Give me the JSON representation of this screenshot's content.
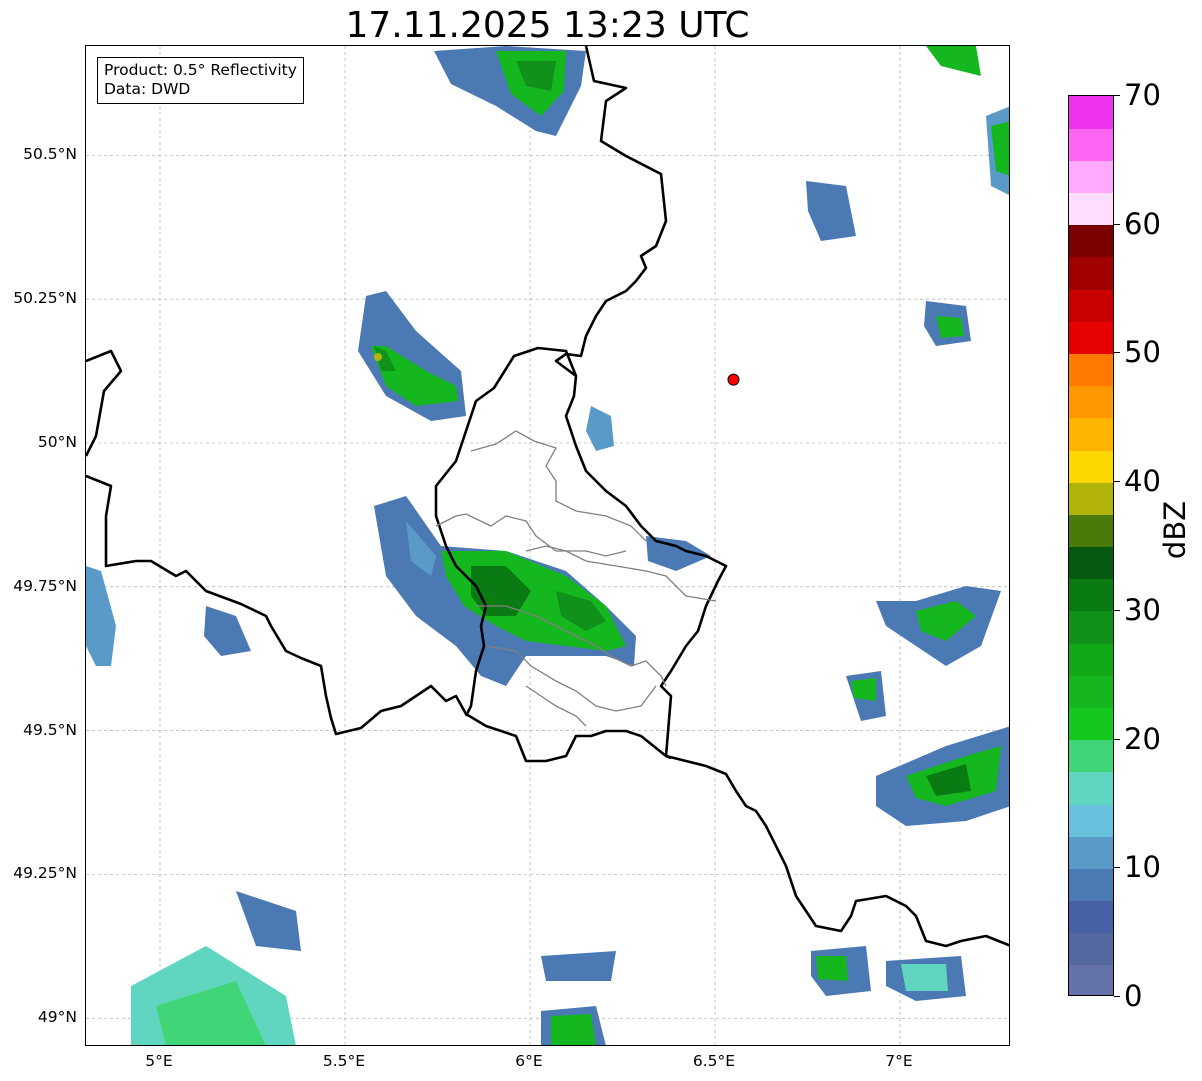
{
  "title": "17.11.2025 13:23 UTC",
  "info": {
    "product": "Product: 0.5° Reflectivity",
    "data": "Data: DWD"
  },
  "map": {
    "lon_range": [
      4.8,
      7.3
    ],
    "lat_range": [
      48.95,
      50.69
    ],
    "lon_ticks": [
      {
        "value": 5.0,
        "label": "5°E"
      },
      {
        "value": 5.5,
        "label": "5.5°E"
      },
      {
        "value": 6.0,
        "label": "6°E"
      },
      {
        "value": 6.5,
        "label": "6.5°E"
      },
      {
        "value": 7.0,
        "label": "7°E"
      }
    ],
    "lat_ticks": [
      {
        "value": 50.5,
        "label": "50.5°N"
      },
      {
        "value": 50.25,
        "label": "50.25°N"
      },
      {
        "value": 50.0,
        "label": "50°N"
      },
      {
        "value": 49.75,
        "label": "49.75°N"
      },
      {
        "value": 49.5,
        "label": "49.5°N"
      },
      {
        "value": 49.25,
        "label": "49.25°N"
      },
      {
        "value": 49.0,
        "label": "49°N"
      }
    ],
    "gridlines": true,
    "radar_site": {
      "lon": 6.55,
      "lat": 50.11,
      "color": "#ff0000"
    },
    "colors": {
      "border": "#000000",
      "admin_border": "#808080",
      "grid": "#b0b0b0"
    }
  },
  "colorbar": {
    "unit": "dBZ",
    "min": 0,
    "max": 70,
    "ticks": [
      {
        "value": 0,
        "label": "0"
      },
      {
        "value": 10,
        "label": "10"
      },
      {
        "value": 20,
        "label": "20"
      },
      {
        "value": 30,
        "label": "30"
      },
      {
        "value": 40,
        "label": "40"
      },
      {
        "value": 50,
        "label": "50"
      },
      {
        "value": 60,
        "label": "60"
      },
      {
        "value": 70,
        "label": "70"
      }
    ],
    "colors": [
      "#6373a8",
      "#5468a0",
      "#4560a4",
      "#4a79b4",
      "#5a9ac8",
      "#68c0dc",
      "#60d6c0",
      "#40d678",
      "#14c81e",
      "#14b81e",
      "#12a818",
      "#10921a",
      "#0a7a12",
      "#055a10",
      "#4a7a0a",
      "#b0b40a",
      "#ffd700",
      "#ffb400",
      "#ff9800",
      "#ff7800",
      "#e60000",
      "#c80000",
      "#a00000",
      "#7a0000",
      "#ffddff",
      "#ffaaff",
      "#ff66f4",
      "#ee33ee"
    ]
  }
}
